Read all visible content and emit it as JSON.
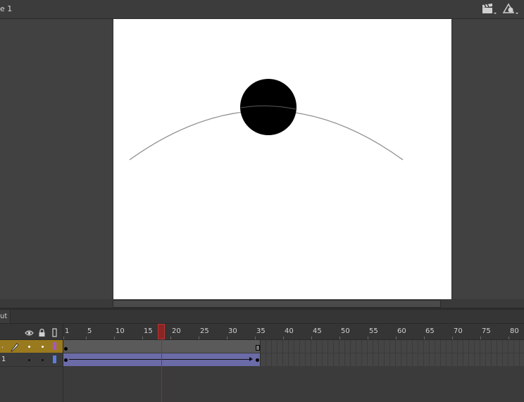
{
  "toolbar": {
    "scene_label": "e 1",
    "edit_scene_icon": "clapperboard-icon",
    "edit_symbols_icon": "symbol-shapes-icon"
  },
  "stage": {
    "background": "#ffffff",
    "guide_path_color": "#8c8c8c",
    "ball_color": "#000000"
  },
  "panel": {
    "tab_label": "ut"
  },
  "timeline": {
    "header_icons": [
      "eye-icon",
      "lock-icon",
      "outline-icon"
    ],
    "ruler_labels": [
      "1",
      "5",
      "10",
      "15",
      "20",
      "25",
      "30",
      "35",
      "40",
      "45",
      "50",
      "55",
      "60",
      "65",
      "70",
      "75",
      "80"
    ],
    "current_frame": 18,
    "layers": [
      {
        "name": ".",
        "type": "guide",
        "color": "#a855c8",
        "highlight": "#9a7a1e"
      },
      {
        "name": "1",
        "type": "normal",
        "color": "#5a7de0"
      }
    ],
    "tween_start_frame": 1,
    "tween_end_frame": 35
  }
}
